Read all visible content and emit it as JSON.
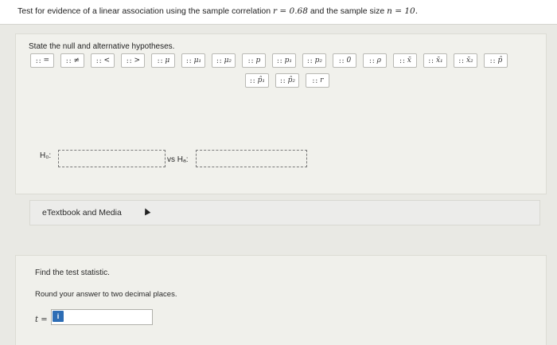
{
  "header": {
    "question_prefix": "Test for evidence of a linear association using the sample correlation",
    "r_label": "r = 0.68",
    "conj": "and the sample size",
    "n_label": "n = 10."
  },
  "hypotheses": {
    "prompt": "State the null and alternative hypotheses.",
    "tokens_row1": [
      "=",
      "≠",
      "<",
      ">",
      "μ",
      "μ₁",
      "μ₂",
      "p",
      "p₁",
      "p₂",
      "0",
      "ρ",
      "x̄",
      "x̄₁",
      "x̄₂",
      "p̂"
    ],
    "tokens_row2": [
      "p̂₁",
      "p̂₂",
      "r"
    ],
    "h0_label": "H₀:",
    "vs_label": "vs Hₐ:"
  },
  "etextbook": {
    "label": "eTextbook and Media"
  },
  "test_stat": {
    "find_label": "Find the test statistic.",
    "round_label": "Round your answer to two decimal places.",
    "t_label": "t =",
    "info_badge": "i"
  }
}
